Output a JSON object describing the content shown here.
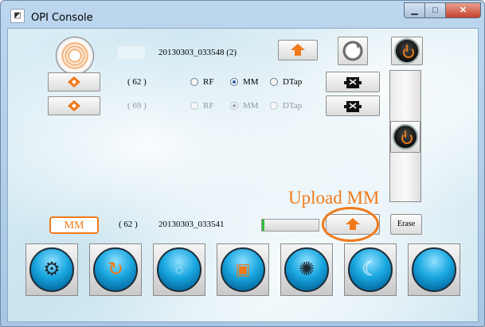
{
  "window": {
    "title": "OPI Console",
    "icon": "app-icon",
    "controls": {
      "minimize": "▁",
      "maximize": "□",
      "close": "✕"
    }
  },
  "top": {
    "filename": "20130303_033548 (2)",
    "upload_icon": "orange-up-arrow-icon",
    "refresh_icon": "refresh-icon",
    "power_icon": "power-icon"
  },
  "row1": {
    "count": "( 62 )",
    "radios": [
      "RF",
      "MM",
      "DTap"
    ],
    "selected": "MM",
    "action_icon": "puzzle-icon"
  },
  "row2": {
    "count": "( 69 )",
    "radios": [
      "RF",
      "MM",
      "DTap"
    ],
    "selected": "MM",
    "disabled": true,
    "action_icon": "puzzle-icon"
  },
  "upload_label": "Upload MM",
  "bottom": {
    "mode_label": "MM",
    "count": "( 62 )",
    "filename": "20130303_033541",
    "progress": 0.02,
    "erase_label": "Erase"
  },
  "toolbar": {
    "icons": [
      "gear-icon",
      "rotate-wave-icon",
      "waveform-icon",
      "signal-square-icon",
      "settings-badge-icon",
      "moon-icon",
      "blank-orb-icon"
    ]
  },
  "colors": {
    "accent": "#f07a1a",
    "orb": "#1aa7e0",
    "progress": "#2fbf3a"
  }
}
